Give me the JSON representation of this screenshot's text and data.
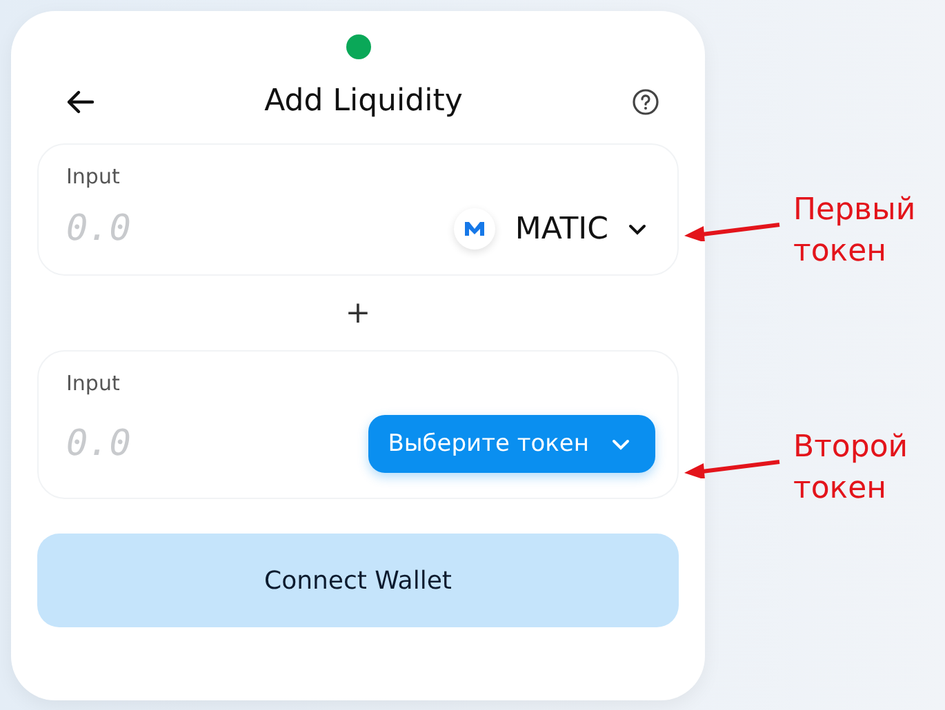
{
  "status_dot": {
    "color": "#0aa858"
  },
  "header": {
    "title": "Add Liquidity"
  },
  "inputs": [
    {
      "label": "Input",
      "placeholder": "0.0",
      "token": {
        "kind": "chosen",
        "symbol": "MATIC"
      }
    },
    {
      "label": "Input",
      "placeholder": "0.0",
      "token": {
        "kind": "picker",
        "symbol": "Выберите токен"
      }
    }
  ],
  "separator": "+",
  "connect_button": "Connect Wallet",
  "annotations": [
    "Первый токен",
    "Второй токен"
  ]
}
